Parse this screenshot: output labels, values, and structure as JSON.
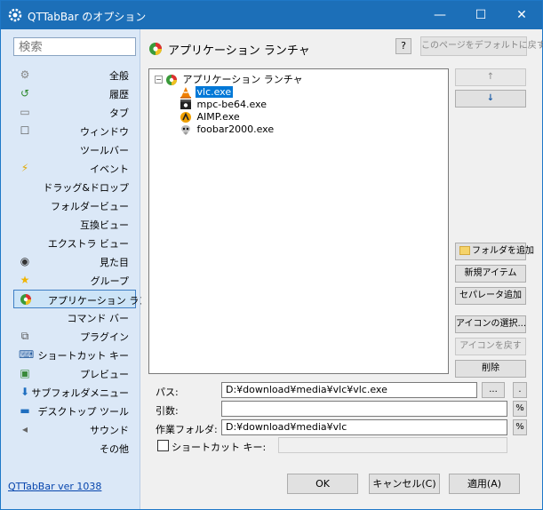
{
  "window": {
    "title": "QTTabBar のオプション",
    "minimize": "—",
    "maximize": "☐",
    "close": "✕"
  },
  "sidebar": {
    "search_placeholder": "検索",
    "items": [
      {
        "label": "全般",
        "icon": "gear-icon"
      },
      {
        "label": "履歴",
        "icon": "history-icon"
      },
      {
        "label": "タブ",
        "icon": "tab-icon"
      },
      {
        "label": "ウィンドウ",
        "icon": "window-icon"
      },
      {
        "label": "ツールバー",
        "icon": ""
      },
      {
        "label": "イベント",
        "icon": "lightning-icon"
      },
      {
        "label": "ドラッグ&ドロップ",
        "icon": ""
      },
      {
        "label": "フォルダービュー",
        "icon": ""
      },
      {
        "label": "互換ビュー",
        "icon": ""
      },
      {
        "label": "エクストラ ビュー",
        "icon": ""
      },
      {
        "label": "見た目",
        "icon": "eye-icon"
      },
      {
        "label": "グループ",
        "icon": "star-icon"
      },
      {
        "label": "アプリケーション ランチャ",
        "icon": "launcher-icon"
      },
      {
        "label": "コマンド バー",
        "icon": ""
      },
      {
        "label": "プラグイン",
        "icon": "plugin-icon"
      },
      {
        "label": "ショートカット キー",
        "icon": "keyboard-icon"
      },
      {
        "label": "プレビュー",
        "icon": "preview-icon"
      },
      {
        "label": "サブフォルダメニュー",
        "icon": "subfolder-icon"
      },
      {
        "label": "デスクトップ ツール",
        "icon": "desktop-icon"
      },
      {
        "label": "サウンド",
        "icon": "sound-icon"
      },
      {
        "label": "その他",
        "icon": ""
      }
    ],
    "selected_index": 12,
    "version_link": "QTTabBar ver 1038"
  },
  "content": {
    "title": "アプリケーション ランチャ",
    "help_label": "?",
    "reset_label": "このページをデフォルトに戻す",
    "tree": {
      "root": "アプリケーション ランチャ",
      "expander": "−",
      "items": [
        {
          "label": "vlc.exe",
          "icon": "vlc-icon",
          "selected": true
        },
        {
          "label": "mpc-be64.exe",
          "icon": "mpc-icon",
          "selected": false
        },
        {
          "label": "AIMP.exe",
          "icon": "aimp-icon",
          "selected": false
        },
        {
          "label": "foobar2000.exe",
          "icon": "foobar-icon",
          "selected": false
        }
      ]
    },
    "side_buttons": {
      "up": "↑",
      "down": "↓",
      "add_folder": "フォルダを追加",
      "new_item": "新規アイテム",
      "add_separator": "セパレータ追加",
      "select_icon": "アイコンの選択...",
      "restore_icon": "アイコンを戻す",
      "delete": "削除"
    },
    "fields": {
      "path_label": "パス:",
      "path_value": "D:¥download¥media¥vlc¥vlc.exe",
      "browse": "...",
      "dot": ".",
      "args_label": "引数:",
      "args_value": "",
      "workdir_label": "作業フォルダ:",
      "workdir_value": "D:¥download¥media¥vlc",
      "percent": "%",
      "shortcut_label": "ショートカット キー:"
    }
  },
  "footer": {
    "ok": "OK",
    "cancel": "キャンセル(C)",
    "apply": "適用(A)"
  },
  "colors": {
    "titlebar": "#1c6fb8",
    "sidebar": "#dbe8f7",
    "selection": "#0078d7"
  }
}
